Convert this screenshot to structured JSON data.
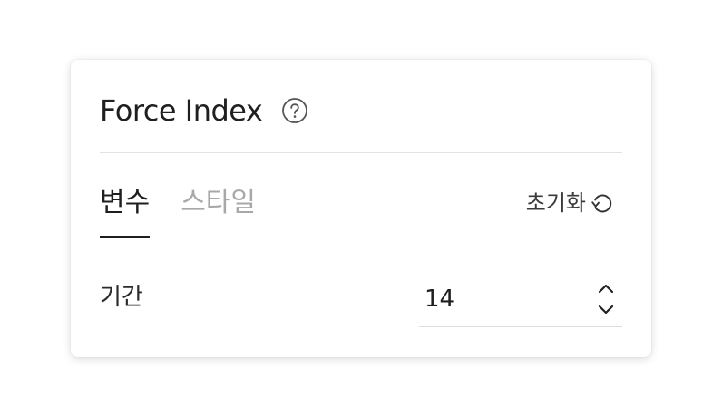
{
  "dialog": {
    "title": "Force Index",
    "help_icon": "question-circle-icon"
  },
  "tabs": [
    {
      "label": "변수",
      "active": true
    },
    {
      "label": "스타일",
      "active": false
    }
  ],
  "reset": {
    "label": "초기화",
    "icon": "reset-rotate-icon"
  },
  "fields": {
    "period": {
      "label": "기간",
      "value": "14",
      "stepper_up_icon": "chevron-up-icon",
      "stepper_down_icon": "chevron-down-icon"
    }
  },
  "colors": {
    "text": "#1f1f1f",
    "tab_inactive": "#a8a8a8",
    "divider": "#e3e3e3"
  }
}
